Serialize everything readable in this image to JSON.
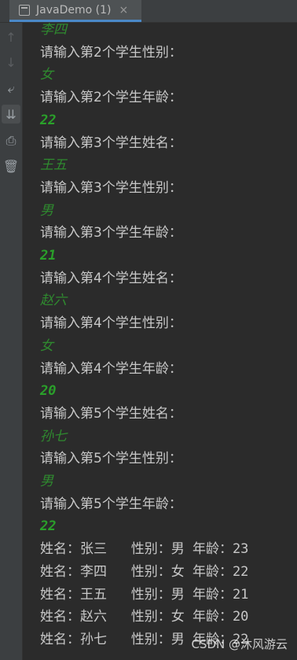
{
  "tab": {
    "title": "JavaDemo (1)",
    "close": "×"
  },
  "gutter": {
    "up": "↑",
    "down": "↓",
    "wrap": "⤶",
    "scroll_end": "⇊",
    "print": "⎙",
    "trash": "🗑"
  },
  "console": {
    "lines": [
      {
        "kind": "input-text",
        "text": "李四"
      },
      {
        "kind": "prompt",
        "text": "请输入第2个学生性别："
      },
      {
        "kind": "input-text",
        "text": "女"
      },
      {
        "kind": "prompt",
        "text": "请输入第2个学生年龄："
      },
      {
        "kind": "input-num",
        "text": "22"
      },
      {
        "kind": "prompt",
        "text": "请输入第3个学生姓名："
      },
      {
        "kind": "input-text",
        "text": "王五"
      },
      {
        "kind": "prompt",
        "text": "请输入第3个学生性别："
      },
      {
        "kind": "input-text",
        "text": "男"
      },
      {
        "kind": "prompt",
        "text": "请输入第3个学生年龄："
      },
      {
        "kind": "input-num",
        "text": "21"
      },
      {
        "kind": "prompt",
        "text": "请输入第4个学生姓名："
      },
      {
        "kind": "input-text",
        "text": "赵六"
      },
      {
        "kind": "prompt",
        "text": "请输入第4个学生性别："
      },
      {
        "kind": "input-text",
        "text": "女"
      },
      {
        "kind": "prompt",
        "text": "请输入第4个学生年龄："
      },
      {
        "kind": "input-num",
        "text": "20"
      },
      {
        "kind": "prompt",
        "text": "请输入第5个学生姓名："
      },
      {
        "kind": "input-text",
        "text": "孙七"
      },
      {
        "kind": "prompt",
        "text": "请输入第5个学生性别："
      },
      {
        "kind": "input-text",
        "text": "男"
      },
      {
        "kind": "prompt",
        "text": "请输入第5个学生年龄："
      },
      {
        "kind": "input-num",
        "text": "22"
      },
      {
        "kind": "result",
        "text": "姓名：张三   性别：男 年龄：23"
      },
      {
        "kind": "result",
        "text": "姓名：李四   性别：女 年龄：22"
      },
      {
        "kind": "result",
        "text": "姓名：王五   性别：男 年龄：21"
      },
      {
        "kind": "result",
        "text": "姓名：赵六   性别：女 年龄：20"
      },
      {
        "kind": "result",
        "text": "姓名：孙七   性别：男 年龄：22"
      }
    ]
  },
  "watermark": "CSDN @沐风游云",
  "colors": {
    "background": "#2b2b2b",
    "tab_accent": "#4a88c7",
    "input_green": "#2aa02a"
  }
}
